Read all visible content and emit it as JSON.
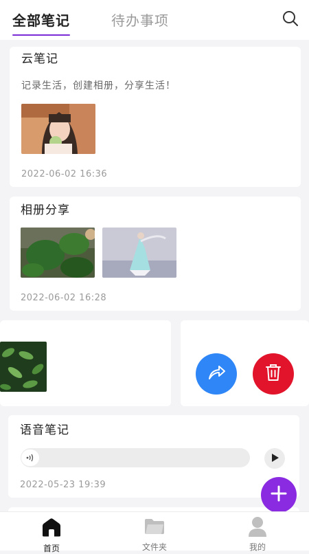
{
  "header": {
    "tabs": [
      {
        "label": "全部笔记",
        "active": true
      },
      {
        "label": "待办事项",
        "active": false
      }
    ],
    "search_icon": "search-icon",
    "accent": "#7a2bd6"
  },
  "notes": [
    {
      "title": "云笔记",
      "text": "记录生活，创建相册，分享生活！",
      "time": "2022-06-02 16:36",
      "images": [
        "photo-girl"
      ]
    },
    {
      "title": "相册分享",
      "time": "2022-06-02 16:28",
      "images": [
        "photo-lotus-leaves",
        "photo-dancer"
      ]
    },
    {
      "images": [
        "photo-green-leaves"
      ],
      "swipe_actions": [
        {
          "name": "share",
          "icon": "share-arrow-icon",
          "color": "#2f86f6"
        },
        {
          "name": "delete",
          "icon": "trash-icon",
          "color": "#e1142b"
        }
      ]
    },
    {
      "title": "语音笔记",
      "time": "2022-05-23 19:39",
      "audio": {
        "icon": "sound-wave-icon",
        "play_icon": "play-icon"
      }
    }
  ],
  "fab": {
    "icon": "plus-icon",
    "color": "#8a2be2"
  },
  "bottom_nav": [
    {
      "label": "首页",
      "icon": "home-icon",
      "active": true
    },
    {
      "label": "文件夹",
      "icon": "folder-icon",
      "active": false
    },
    {
      "label": "我的",
      "icon": "user-icon",
      "active": false
    }
  ]
}
